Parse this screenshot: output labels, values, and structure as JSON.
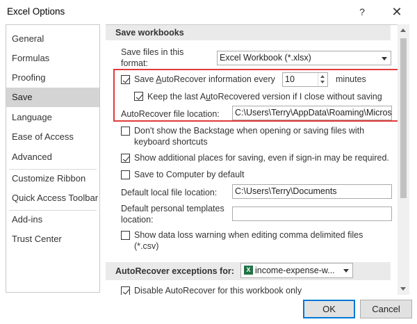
{
  "window": {
    "title": "Excel Options",
    "help_icon": "question-mark",
    "close_icon": "x"
  },
  "sidebar": {
    "items": [
      {
        "label": "General",
        "selected": false
      },
      {
        "label": "Formulas",
        "selected": false
      },
      {
        "label": "Proofing",
        "selected": false
      },
      {
        "label": "Save",
        "selected": true
      },
      {
        "label": "Language",
        "selected": false
      },
      {
        "label": "Ease of Access",
        "selected": false
      },
      {
        "label": "Advanced",
        "selected": false
      },
      {
        "label": "Customize Ribbon",
        "selected": false
      },
      {
        "label": "Quick Access Toolbar",
        "selected": false
      },
      {
        "label": "Add-ins",
        "selected": false
      },
      {
        "label": "Trust Center",
        "selected": false
      }
    ]
  },
  "save_workbooks": {
    "header": "Save workbooks",
    "format_label_1": "Save files in this",
    "format_label_2": "format:",
    "format_value": "Excel Workbook (*.xlsx)",
    "autorecover_label_pre": "Save ",
    "autorecover_label_u": "A",
    "autorecover_label_post": "utoRecover information every",
    "autorecover_checked": true,
    "autorecover_minutes": "10",
    "minutes_label": "minutes",
    "keep_last_pre": "Keep the last A",
    "keep_last_u": "u",
    "keep_last_post": "toRecovered version if I close without saving",
    "keep_last_checked": true,
    "location_label_pre": "AutoRecover file location:",
    "location_value": "C:\\Users\\Terry\\AppData\\Roaming\\Microsoft\\Excel\\",
    "backstage_label_1": "Don't show the Backstage when opening or saving files with",
    "backstage_label_2": "keyboard shortcuts",
    "backstage_checked": false,
    "additional_places_label": "Show additional places for saving, even if sign-in may be required.",
    "additional_places_checked": true,
    "save_computer_label": "Save to Computer by default",
    "save_computer_checked": false,
    "default_local_label": "Default local file location:",
    "default_local_value": "C:\\Users\\Terry\\Documents",
    "personal_templates_label_1": "Default personal templates",
    "personal_templates_label_2": "location:",
    "personal_templates_value": "",
    "data_loss_label_1": "Show data loss warning when editing comma delimited files",
    "data_loss_label_2": "(*.csv)",
    "data_loss_checked": false
  },
  "autorecover_exceptions": {
    "header": "AutoRecover exceptions for:",
    "workbook_value": "income-expense-w...",
    "workbook_icon_letter": "X",
    "disable_label": "Disable AutoRecover for this workbook only",
    "disable_checked": true
  },
  "footer": {
    "ok_label": "OK",
    "cancel_label": "Cancel"
  },
  "colors": {
    "highlight": "#e03a3a",
    "excel_green": "#1f7244",
    "ok_border": "#0078d7"
  }
}
